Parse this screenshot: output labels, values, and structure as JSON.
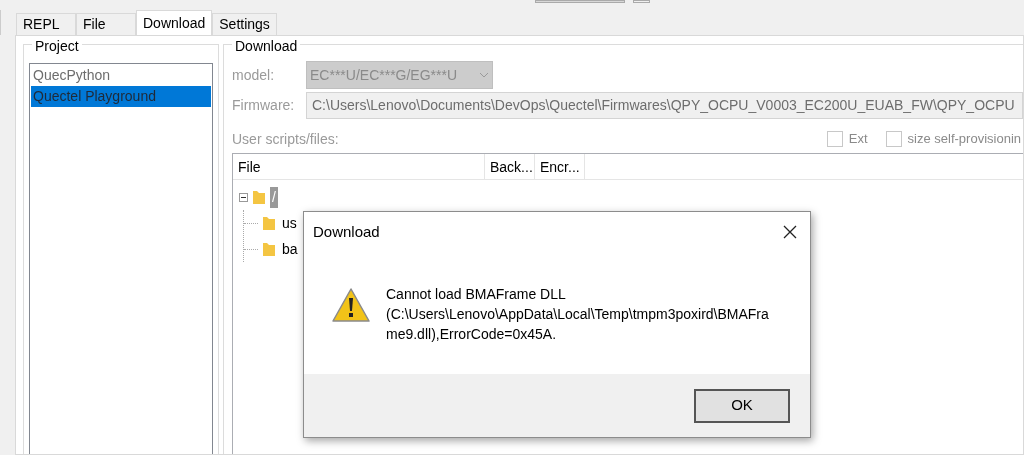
{
  "tabs": [
    {
      "label": "REPL",
      "selected": false
    },
    {
      "label": "File",
      "selected": false
    },
    {
      "label": "Download",
      "selected": true
    },
    {
      "label": "Settings",
      "selected": false
    }
  ],
  "project": {
    "title": "Project",
    "items": [
      {
        "label": "QuecPython",
        "selected": false
      },
      {
        "label": "Quectel Playground",
        "selected": true
      }
    ]
  },
  "download": {
    "title": "Download",
    "model_label": "model:",
    "model_value": "EC***U/EC***G/EG***U",
    "model_disabled": true,
    "firmware_label": "Firmware:",
    "firmware_value": "C:\\Users\\Lenovo\\Documents\\DevOps\\Quectel\\Firmwares\\QPY_OCPU_V0003_EC200U_EUAB_FW\\QPY_OCPU",
    "scripts_label": "User scripts/files:",
    "options": [
      {
        "label": "Ext",
        "checked": false
      },
      {
        "label": "size self-provisionin",
        "checked": false
      }
    ],
    "columns": [
      "File",
      "Back...",
      "Encr..."
    ],
    "tree": [
      {
        "label": "/",
        "selected": true,
        "expanded": true,
        "children": [
          {
            "label": "us",
            "selected": false
          },
          {
            "label": "ba",
            "selected": false
          }
        ]
      }
    ]
  },
  "dialog": {
    "title": "Download",
    "message": "Cannot load BMAFrame DLL (C:\\Users\\Lenovo\\AppData\\Local\\Temp\\tmpm3poxird\\BMAFrame9.dll),ErrorCode=0x45A.",
    "button": "OK"
  }
}
